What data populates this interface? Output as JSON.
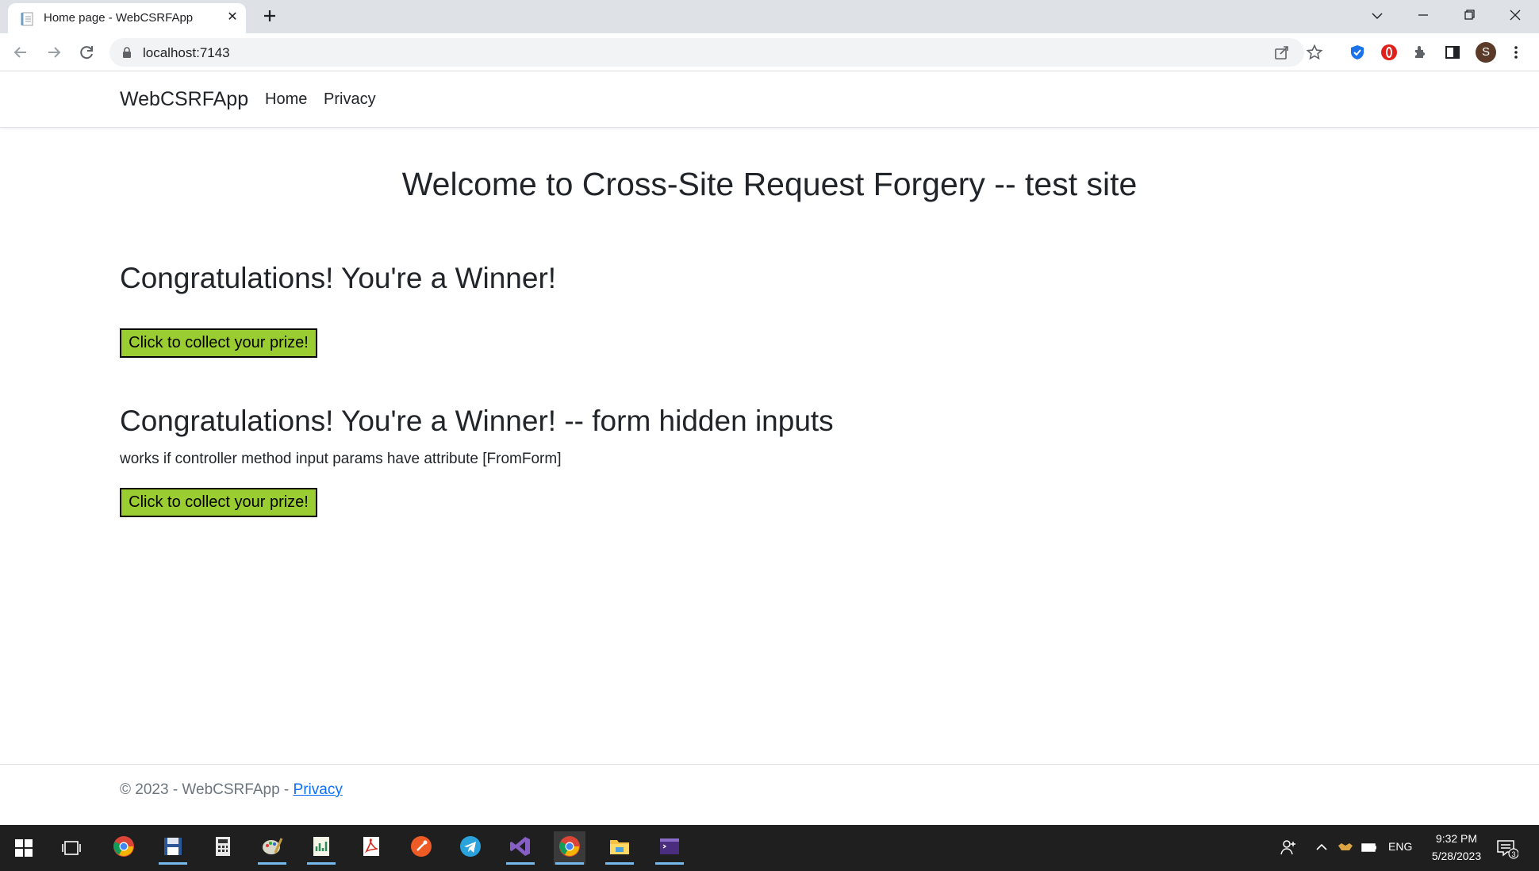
{
  "browser": {
    "tab_title": "Home page - WebCSRFApp",
    "url": "localhost:7143",
    "profile_initial": "S"
  },
  "site": {
    "brand": "WebCSRFApp",
    "nav": [
      "Home",
      "Privacy"
    ],
    "welcome": "Welcome to Cross-Site Request Forgery -- test site",
    "section1": {
      "heading": "Congratulations! You're a Winner!",
      "button": "Click to collect your prize!"
    },
    "section2": {
      "heading": "Congratulations! You're a Winner! -- form hidden inputs",
      "note": "works if controller method input params have attribute [FromForm]",
      "button": "Click to collect your prize!"
    },
    "footer": {
      "text": "© 2023 - WebCSRFApp - ",
      "link": "Privacy"
    },
    "accent_button_color": "#9acd32",
    "link_color": "#0d6efd"
  },
  "taskbar": {
    "language": "ENG",
    "time": "9:32 PM",
    "date": "5/28/2023",
    "notification_count": "3"
  }
}
